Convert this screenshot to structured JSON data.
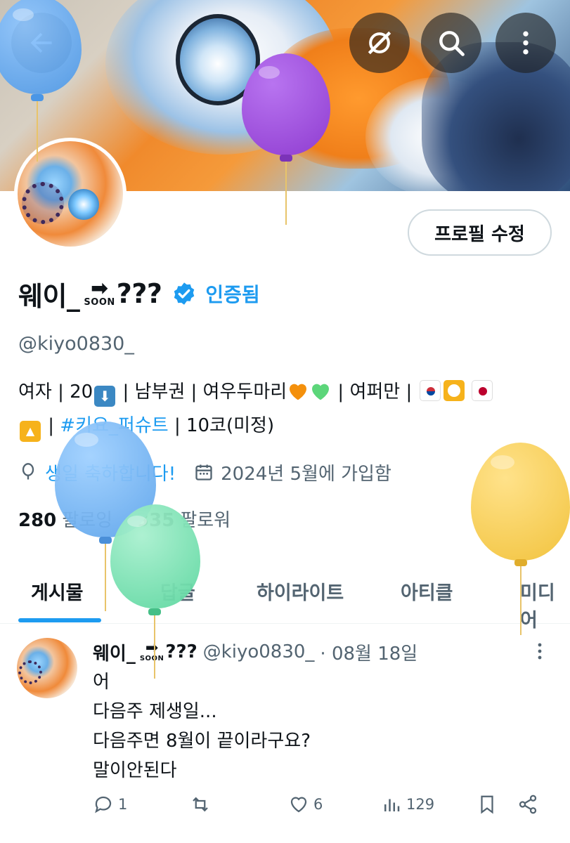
{
  "header": {
    "back_icon": "arrow-left-icon",
    "buttons": [
      {
        "name": "mute-visibility-icon"
      },
      {
        "name": "search-icon"
      },
      {
        "name": "more-vertical-icon"
      }
    ]
  },
  "profile": {
    "edit_label": "프로필 수정",
    "name_prefix": "웨이_",
    "soon_arrow": "➡",
    "soon_text": "SOON",
    "name_suffix": "???",
    "verified_label": "인증됨",
    "handle": "@kiyo0830_",
    "bio_line1_a": "여자 | 20",
    "bio_line1_b": " | 남부권 | 여우두마리",
    "bio_line1_c": " | 여퍼만 | ",
    "bio_line2_a": " | ",
    "bio_hashtag": "#키요_퍼슈트",
    "bio_line2_b": " | 10코(미정)",
    "birthday_text": "생일 축하합니다!",
    "joined_text": "2024년 5월에 가입함",
    "following_count": "280",
    "following_label": "팔로잉",
    "followers_count": "335",
    "followers_label": "팔로워"
  },
  "tabs": [
    {
      "label": "게시물",
      "active": true
    },
    {
      "label": "답글",
      "active": false
    },
    {
      "label": "하이라이트",
      "active": false
    },
    {
      "label": "아티클",
      "active": false
    },
    {
      "label": "미디어",
      "active": false
    }
  ],
  "post": {
    "name_prefix": "웨이_",
    "soon_arrow": "➡",
    "soon_text": "SOON",
    "name_suffix": "???",
    "handle": "@kiyo0830_",
    "date": "· 08월 18일",
    "lines": [
      "어",
      "다음주 제생일...",
      "다음주면 8월이 끝이라구요?",
      "말이안된다"
    ],
    "replies": "1",
    "reposts": "",
    "likes": "6",
    "views": "129"
  },
  "colors": {
    "accent": "#1d9bf0",
    "balloon_blue": "#5aa6ee",
    "balloon_purple": "#9b45d9",
    "balloon_green": "#6fe0ad",
    "balloon_yellow": "#f6cf4f"
  }
}
